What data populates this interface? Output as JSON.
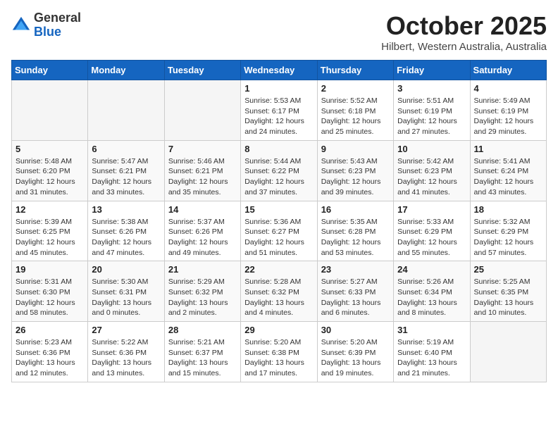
{
  "header": {
    "logo_general": "General",
    "logo_blue": "Blue",
    "month": "October 2025",
    "location": "Hilbert, Western Australia, Australia"
  },
  "weekdays": [
    "Sunday",
    "Monday",
    "Tuesday",
    "Wednesday",
    "Thursday",
    "Friday",
    "Saturday"
  ],
  "weeks": [
    [
      {
        "day": "",
        "info": ""
      },
      {
        "day": "",
        "info": ""
      },
      {
        "day": "",
        "info": ""
      },
      {
        "day": "1",
        "info": "Sunrise: 5:53 AM\nSunset: 6:17 PM\nDaylight: 12 hours\nand 24 minutes."
      },
      {
        "day": "2",
        "info": "Sunrise: 5:52 AM\nSunset: 6:18 PM\nDaylight: 12 hours\nand 25 minutes."
      },
      {
        "day": "3",
        "info": "Sunrise: 5:51 AM\nSunset: 6:19 PM\nDaylight: 12 hours\nand 27 minutes."
      },
      {
        "day": "4",
        "info": "Sunrise: 5:49 AM\nSunset: 6:19 PM\nDaylight: 12 hours\nand 29 minutes."
      }
    ],
    [
      {
        "day": "5",
        "info": "Sunrise: 5:48 AM\nSunset: 6:20 PM\nDaylight: 12 hours\nand 31 minutes."
      },
      {
        "day": "6",
        "info": "Sunrise: 5:47 AM\nSunset: 6:21 PM\nDaylight: 12 hours\nand 33 minutes."
      },
      {
        "day": "7",
        "info": "Sunrise: 5:46 AM\nSunset: 6:21 PM\nDaylight: 12 hours\nand 35 minutes."
      },
      {
        "day": "8",
        "info": "Sunrise: 5:44 AM\nSunset: 6:22 PM\nDaylight: 12 hours\nand 37 minutes."
      },
      {
        "day": "9",
        "info": "Sunrise: 5:43 AM\nSunset: 6:23 PM\nDaylight: 12 hours\nand 39 minutes."
      },
      {
        "day": "10",
        "info": "Sunrise: 5:42 AM\nSunset: 6:23 PM\nDaylight: 12 hours\nand 41 minutes."
      },
      {
        "day": "11",
        "info": "Sunrise: 5:41 AM\nSunset: 6:24 PM\nDaylight: 12 hours\nand 43 minutes."
      }
    ],
    [
      {
        "day": "12",
        "info": "Sunrise: 5:39 AM\nSunset: 6:25 PM\nDaylight: 12 hours\nand 45 minutes."
      },
      {
        "day": "13",
        "info": "Sunrise: 5:38 AM\nSunset: 6:26 PM\nDaylight: 12 hours\nand 47 minutes."
      },
      {
        "day": "14",
        "info": "Sunrise: 5:37 AM\nSunset: 6:26 PM\nDaylight: 12 hours\nand 49 minutes."
      },
      {
        "day": "15",
        "info": "Sunrise: 5:36 AM\nSunset: 6:27 PM\nDaylight: 12 hours\nand 51 minutes."
      },
      {
        "day": "16",
        "info": "Sunrise: 5:35 AM\nSunset: 6:28 PM\nDaylight: 12 hours\nand 53 minutes."
      },
      {
        "day": "17",
        "info": "Sunrise: 5:33 AM\nSunset: 6:29 PM\nDaylight: 12 hours\nand 55 minutes."
      },
      {
        "day": "18",
        "info": "Sunrise: 5:32 AM\nSunset: 6:29 PM\nDaylight: 12 hours\nand 57 minutes."
      }
    ],
    [
      {
        "day": "19",
        "info": "Sunrise: 5:31 AM\nSunset: 6:30 PM\nDaylight: 12 hours\nand 58 minutes."
      },
      {
        "day": "20",
        "info": "Sunrise: 5:30 AM\nSunset: 6:31 PM\nDaylight: 13 hours\nand 0 minutes."
      },
      {
        "day": "21",
        "info": "Sunrise: 5:29 AM\nSunset: 6:32 PM\nDaylight: 13 hours\nand 2 minutes."
      },
      {
        "day": "22",
        "info": "Sunrise: 5:28 AM\nSunset: 6:32 PM\nDaylight: 13 hours\nand 4 minutes."
      },
      {
        "day": "23",
        "info": "Sunrise: 5:27 AM\nSunset: 6:33 PM\nDaylight: 13 hours\nand 6 minutes."
      },
      {
        "day": "24",
        "info": "Sunrise: 5:26 AM\nSunset: 6:34 PM\nDaylight: 13 hours\nand 8 minutes."
      },
      {
        "day": "25",
        "info": "Sunrise: 5:25 AM\nSunset: 6:35 PM\nDaylight: 13 hours\nand 10 minutes."
      }
    ],
    [
      {
        "day": "26",
        "info": "Sunrise: 5:23 AM\nSunset: 6:36 PM\nDaylight: 13 hours\nand 12 minutes."
      },
      {
        "day": "27",
        "info": "Sunrise: 5:22 AM\nSunset: 6:36 PM\nDaylight: 13 hours\nand 13 minutes."
      },
      {
        "day": "28",
        "info": "Sunrise: 5:21 AM\nSunset: 6:37 PM\nDaylight: 13 hours\nand 15 minutes."
      },
      {
        "day": "29",
        "info": "Sunrise: 5:20 AM\nSunset: 6:38 PM\nDaylight: 13 hours\nand 17 minutes."
      },
      {
        "day": "30",
        "info": "Sunrise: 5:20 AM\nSunset: 6:39 PM\nDaylight: 13 hours\nand 19 minutes."
      },
      {
        "day": "31",
        "info": "Sunrise: 5:19 AM\nSunset: 6:40 PM\nDaylight: 13 hours\nand 21 minutes."
      },
      {
        "day": "",
        "info": ""
      }
    ]
  ]
}
